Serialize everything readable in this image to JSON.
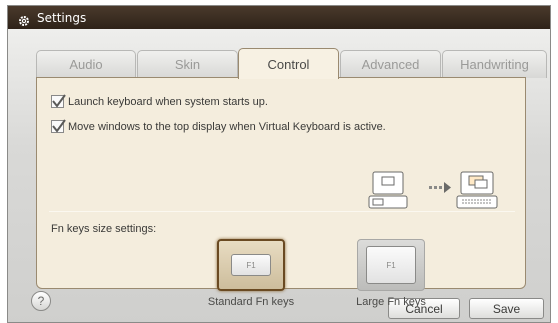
{
  "window": {
    "title": "Settings"
  },
  "tabs": [
    {
      "label": "Audio"
    },
    {
      "label": "Skin"
    },
    {
      "label": "Control",
      "active": true
    },
    {
      "label": "Advanced"
    },
    {
      "label": "Handwriting"
    }
  ],
  "control": {
    "options": [
      {
        "label": "Launch keyboard when system starts up.",
        "checked": true
      },
      {
        "label": "Move windows to the top display when Virtual Keyboard is active.",
        "checked": true
      }
    ],
    "fn_section": {
      "title": "Fn keys size settings:",
      "key_text": "F1",
      "standard_label": "Standard Fn keys",
      "large_label": "Large Fn keys",
      "selected": "standard"
    }
  },
  "footer": {
    "help_label": "?",
    "cancel_label": "Cancel",
    "save_label": "Save"
  },
  "colors": {
    "titlebar": "#3a2c20",
    "panel": "#f4eddd",
    "selected_border": "#6a4a22"
  },
  "icons": [
    "gear-icon",
    "checkmark-icon",
    "laptop-dual-display-icon",
    "arrow-right-icon",
    "help-icon"
  ]
}
